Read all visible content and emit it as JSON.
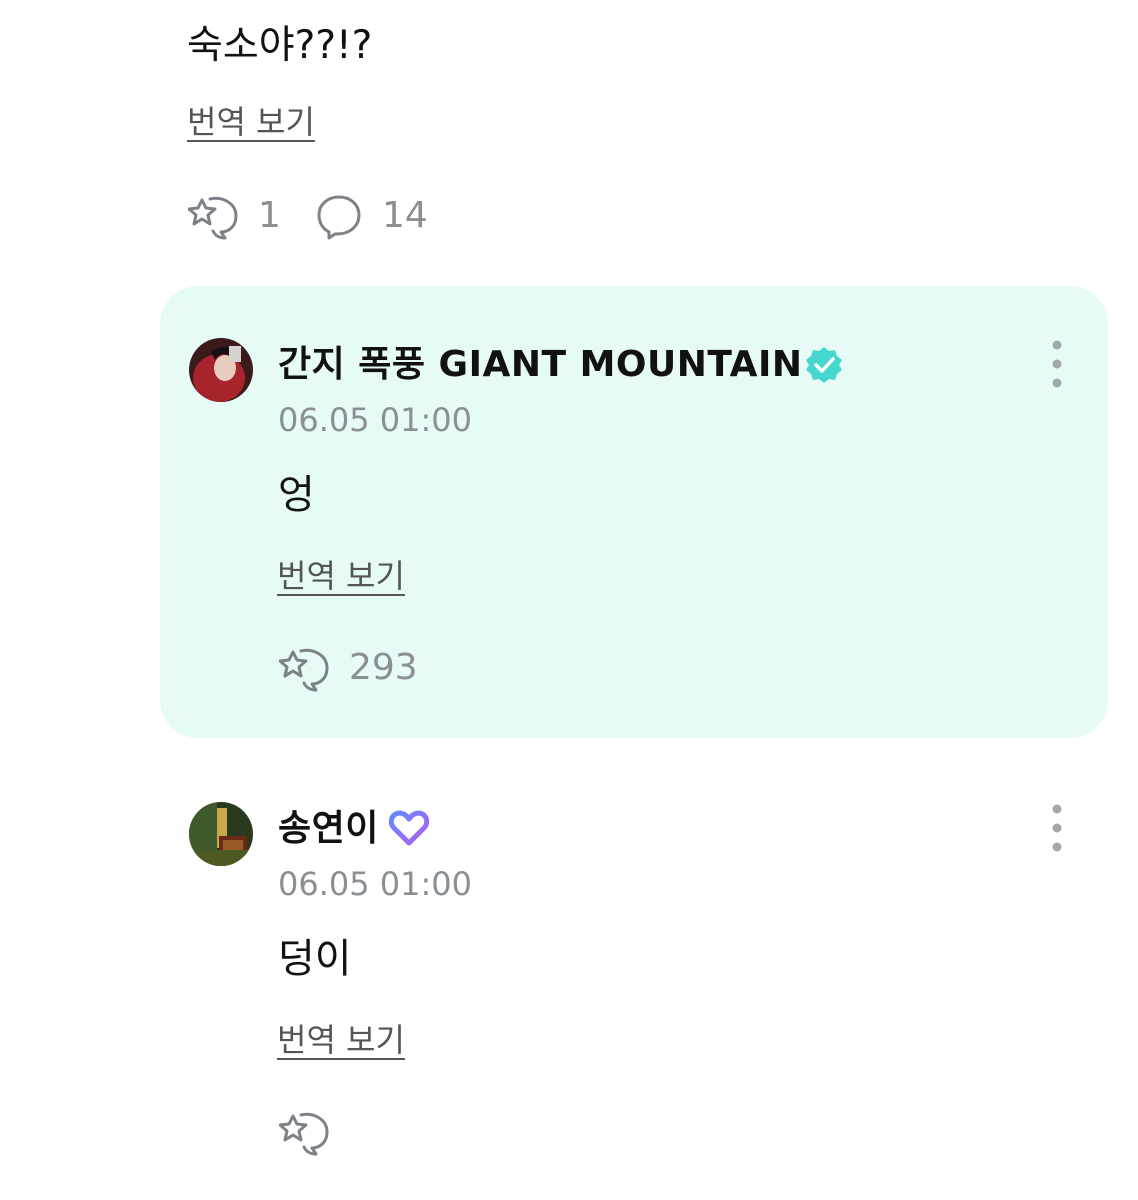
{
  "post": {
    "text": "숙소야??!?",
    "translate_label": "번역 보기",
    "like_count": "1",
    "comment_count": "14",
    "like_icon": "sparkle-heart-icon",
    "comment_icon": "speech-bubble-icon"
  },
  "replies": [
    {
      "author": "간지 폭풍 GIANT MOUNTAIN",
      "badge": "verified-check-badge-icon",
      "badge_color": "#46d8d0",
      "time": "06.05 01:00",
      "text": "엉",
      "translate_label": "번역 보기",
      "like_count": "293",
      "highlighted": true,
      "highlight_color": "#e6fbf6"
    },
    {
      "author": "송연이",
      "badge": "membership-heart-badge-icon",
      "badge_color": "#7c6cf2",
      "time": "06.05 01:00",
      "text": "덩이",
      "translate_label": "번역 보기",
      "like_count": "",
      "highlighted": false
    }
  ],
  "colors": {
    "text_primary": "#111111",
    "text_secondary": "#8a8f94",
    "accent_mint": "#46d8d0"
  }
}
